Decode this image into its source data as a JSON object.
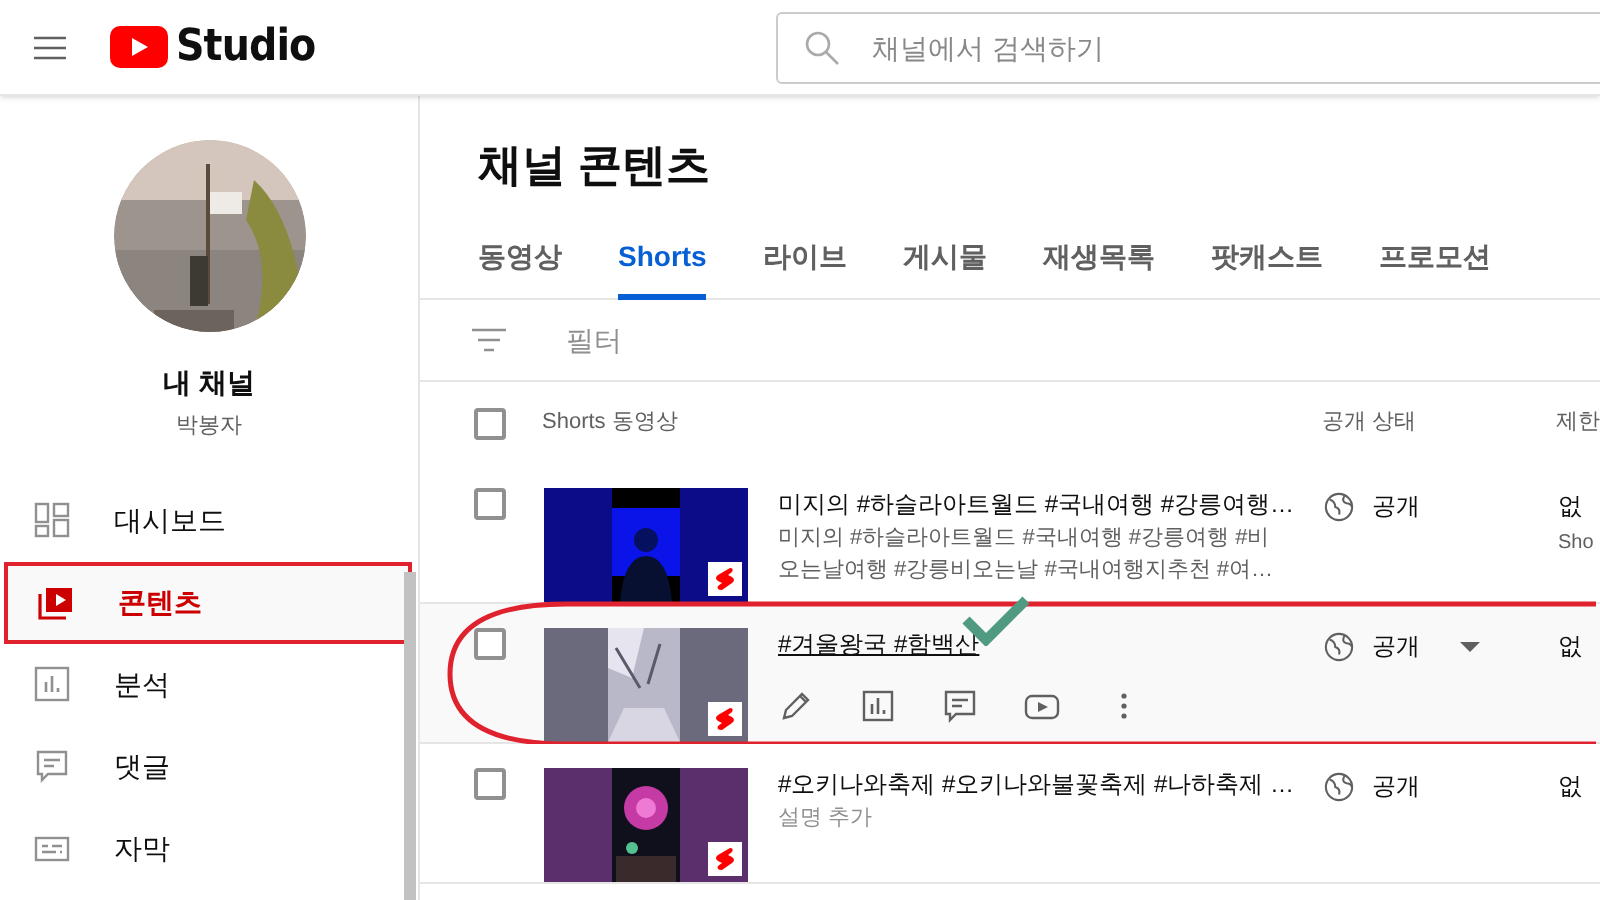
{
  "header": {
    "logo_text": "Studio",
    "search": {
      "placeholder": "채널에서 검색하기"
    }
  },
  "channel": {
    "name": "내 채널",
    "owner": "박봉자"
  },
  "sidebar": {
    "items": [
      {
        "label": "대시보드",
        "selected": false,
        "annotated": false
      },
      {
        "label": "콘텐츠",
        "selected": true,
        "annotated": true
      },
      {
        "label": "분석",
        "selected": false,
        "annotated": false
      },
      {
        "label": "댓글",
        "selected": false,
        "annotated": false
      },
      {
        "label": "자막",
        "selected": false,
        "annotated": false
      }
    ]
  },
  "page_title": "채널 콘텐츠",
  "tabs": [
    {
      "label": "동영상",
      "selected": false
    },
    {
      "label": "Shorts",
      "selected": true
    },
    {
      "label": "라이브",
      "selected": false
    },
    {
      "label": "게시물",
      "selected": false
    },
    {
      "label": "재생목록",
      "selected": false
    },
    {
      "label": "팟캐스트",
      "selected": false
    },
    {
      "label": "프로모션",
      "selected": false
    }
  ],
  "filter": {
    "placeholder": "필터"
  },
  "table": {
    "select_all_checked": false,
    "columns": [
      "Shorts 동영상",
      "공개 상태",
      "제한"
    ],
    "rows": [
      {
        "title": "미지의 #하슬라아트월드 #국내여행 #강릉여행…",
        "title_link": false,
        "description": "미지의 #하슬라아트월드 #국내여행 #강릉여행 #비오는날여행 #강릉비오는날 #국내여행지추천 #여…",
        "description_muted": false,
        "visibility": "공개",
        "restriction": "없",
        "restriction_note": "Sho",
        "hovered": false,
        "annotated": false,
        "checked": false
      },
      {
        "title": "#겨울왕국 #함백산",
        "title_link": true,
        "visibility": "공개",
        "restriction": "없",
        "hovered": true,
        "annotated": true,
        "checked": false
      },
      {
        "title": "#오키나와축제 #오키나와불꽃축제 #나하축제 …",
        "title_link": false,
        "description": "설명 추가",
        "description_muted": true,
        "visibility": "공개",
        "restriction": "없",
        "hovered": false,
        "annotated": false,
        "checked": false
      }
    ]
  }
}
